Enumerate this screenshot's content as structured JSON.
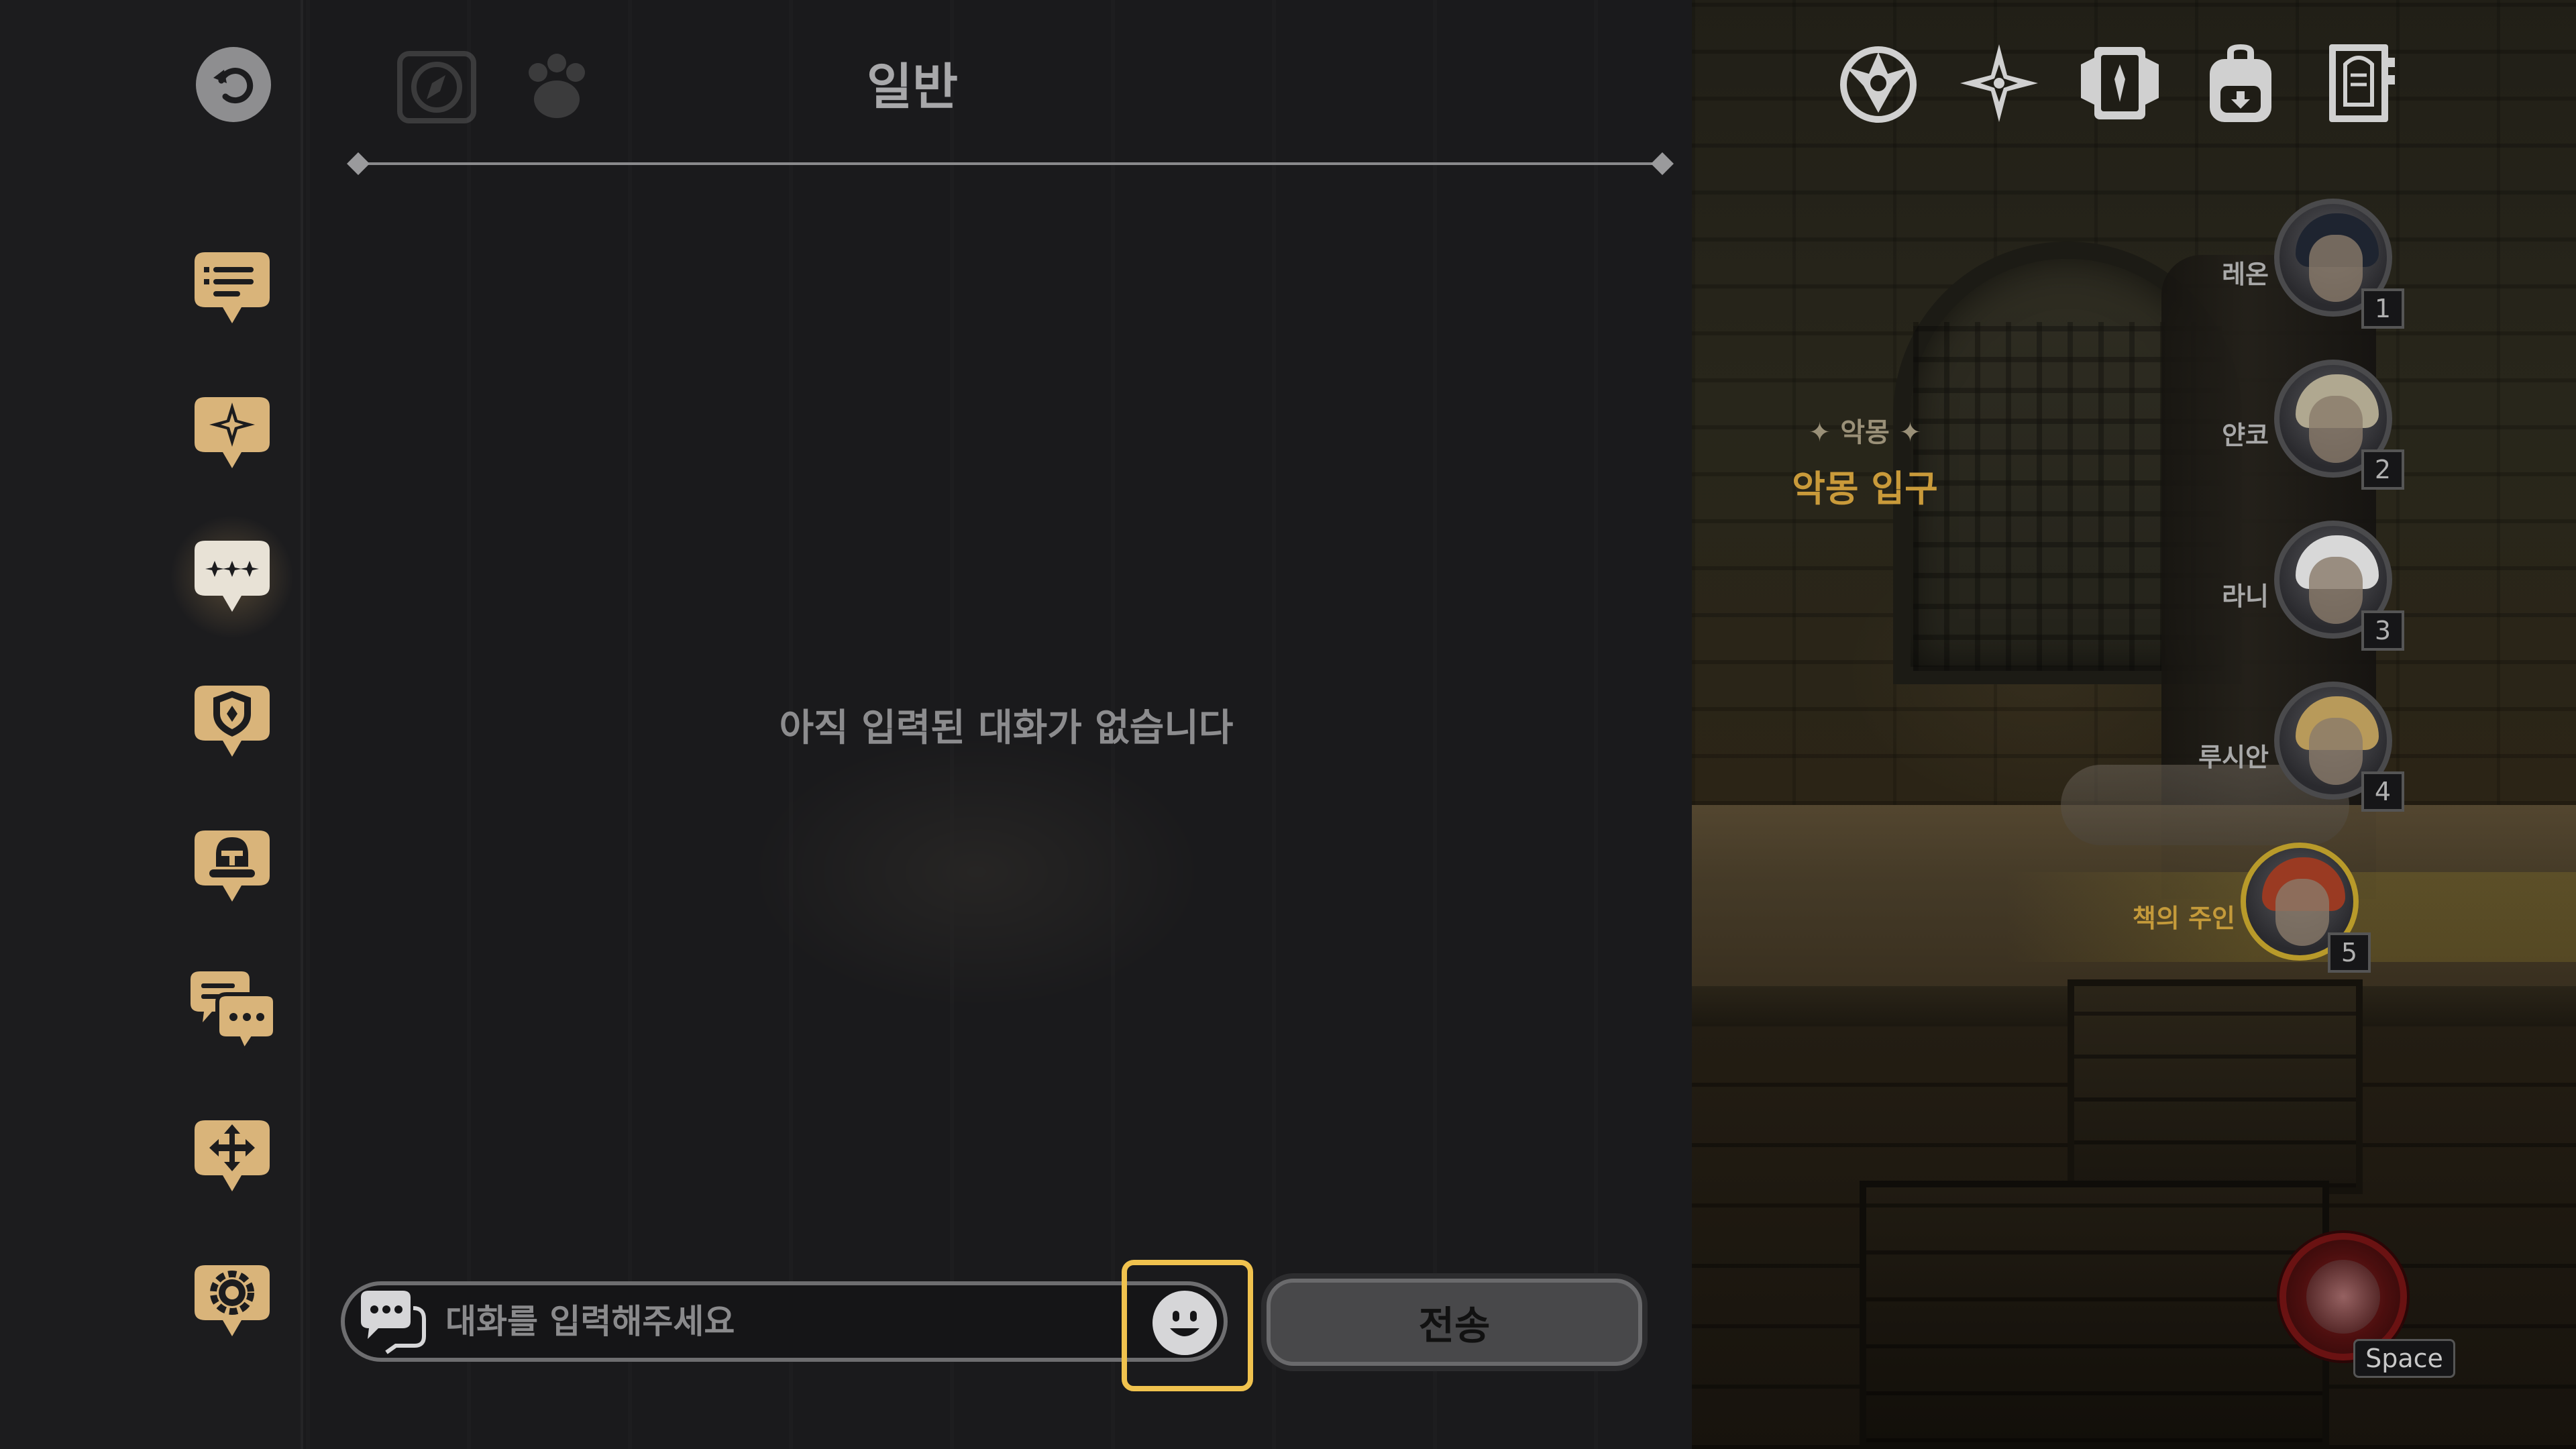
{
  "chat": {
    "title": "일반",
    "empty_message": "아직 입력된 대화가 없습니다",
    "input_placeholder": "대화를 입력해주세요",
    "send_label": "전송"
  },
  "sidebar": {
    "items": [
      {
        "name": "quest-list-icon",
        "active": false
      },
      {
        "name": "star-bubble-icon",
        "active": false
      },
      {
        "name": "general-chat-icon",
        "active": true
      },
      {
        "name": "guild-shield-icon",
        "active": false
      },
      {
        "name": "party-helmet-icon",
        "active": false
      },
      {
        "name": "whisper-chat-icon",
        "active": false
      },
      {
        "name": "move-arrows-icon",
        "active": false
      },
      {
        "name": "settings-gear-icon",
        "active": false
      }
    ]
  },
  "location": {
    "region": "악몽",
    "name": "악몽 입구"
  },
  "party": [
    {
      "name": "레온",
      "slot": "1",
      "selected": false
    },
    {
      "name": "얀코",
      "slot": "2",
      "selected": false
    },
    {
      "name": "라니",
      "slot": "3",
      "selected": false
    },
    {
      "name": "루시안",
      "slot": "4",
      "selected": false
    },
    {
      "name": "책의 주인",
      "slot": "5",
      "selected": true
    }
  ],
  "hud": {
    "icons": [
      "emblem-icon",
      "compass-star-icon",
      "card-deck-icon",
      "backpack-icon",
      "codex-book-icon"
    ]
  },
  "skill": {
    "key_label": "Space"
  },
  "colors": {
    "accent_gold": "#f0c24e",
    "sidebar_icon": "#d9b47a",
    "location_gold": "#c99a3a"
  }
}
